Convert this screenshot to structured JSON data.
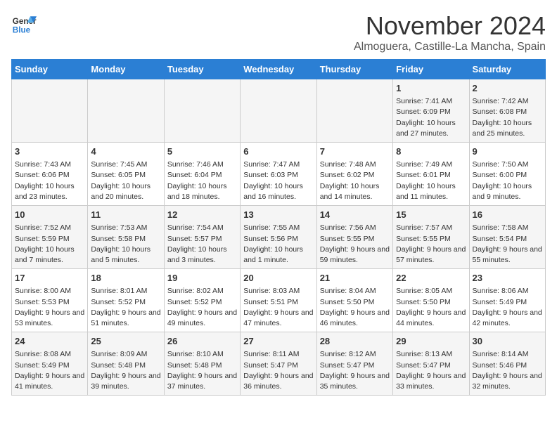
{
  "header": {
    "logo_line1": "General",
    "logo_line2": "Blue",
    "month": "November 2024",
    "location": "Almoguera, Castille-La Mancha, Spain"
  },
  "weekdays": [
    "Sunday",
    "Monday",
    "Tuesday",
    "Wednesday",
    "Thursday",
    "Friday",
    "Saturday"
  ],
  "weeks": [
    [
      {
        "day": "",
        "info": ""
      },
      {
        "day": "",
        "info": ""
      },
      {
        "day": "",
        "info": ""
      },
      {
        "day": "",
        "info": ""
      },
      {
        "day": "",
        "info": ""
      },
      {
        "day": "1",
        "info": "Sunrise: 7:41 AM\nSunset: 6:09 PM\nDaylight: 10 hours and 27 minutes."
      },
      {
        "day": "2",
        "info": "Sunrise: 7:42 AM\nSunset: 6:08 PM\nDaylight: 10 hours and 25 minutes."
      }
    ],
    [
      {
        "day": "3",
        "info": "Sunrise: 7:43 AM\nSunset: 6:06 PM\nDaylight: 10 hours and 23 minutes."
      },
      {
        "day": "4",
        "info": "Sunrise: 7:45 AM\nSunset: 6:05 PM\nDaylight: 10 hours and 20 minutes."
      },
      {
        "day": "5",
        "info": "Sunrise: 7:46 AM\nSunset: 6:04 PM\nDaylight: 10 hours and 18 minutes."
      },
      {
        "day": "6",
        "info": "Sunrise: 7:47 AM\nSunset: 6:03 PM\nDaylight: 10 hours and 16 minutes."
      },
      {
        "day": "7",
        "info": "Sunrise: 7:48 AM\nSunset: 6:02 PM\nDaylight: 10 hours and 14 minutes."
      },
      {
        "day": "8",
        "info": "Sunrise: 7:49 AM\nSunset: 6:01 PM\nDaylight: 10 hours and 11 minutes."
      },
      {
        "day": "9",
        "info": "Sunrise: 7:50 AM\nSunset: 6:00 PM\nDaylight: 10 hours and 9 minutes."
      }
    ],
    [
      {
        "day": "10",
        "info": "Sunrise: 7:52 AM\nSunset: 5:59 PM\nDaylight: 10 hours and 7 minutes."
      },
      {
        "day": "11",
        "info": "Sunrise: 7:53 AM\nSunset: 5:58 PM\nDaylight: 10 hours and 5 minutes."
      },
      {
        "day": "12",
        "info": "Sunrise: 7:54 AM\nSunset: 5:57 PM\nDaylight: 10 hours and 3 minutes."
      },
      {
        "day": "13",
        "info": "Sunrise: 7:55 AM\nSunset: 5:56 PM\nDaylight: 10 hours and 1 minute."
      },
      {
        "day": "14",
        "info": "Sunrise: 7:56 AM\nSunset: 5:55 PM\nDaylight: 9 hours and 59 minutes."
      },
      {
        "day": "15",
        "info": "Sunrise: 7:57 AM\nSunset: 5:55 PM\nDaylight: 9 hours and 57 minutes."
      },
      {
        "day": "16",
        "info": "Sunrise: 7:58 AM\nSunset: 5:54 PM\nDaylight: 9 hours and 55 minutes."
      }
    ],
    [
      {
        "day": "17",
        "info": "Sunrise: 8:00 AM\nSunset: 5:53 PM\nDaylight: 9 hours and 53 minutes."
      },
      {
        "day": "18",
        "info": "Sunrise: 8:01 AM\nSunset: 5:52 PM\nDaylight: 9 hours and 51 minutes."
      },
      {
        "day": "19",
        "info": "Sunrise: 8:02 AM\nSunset: 5:52 PM\nDaylight: 9 hours and 49 minutes."
      },
      {
        "day": "20",
        "info": "Sunrise: 8:03 AM\nSunset: 5:51 PM\nDaylight: 9 hours and 47 minutes."
      },
      {
        "day": "21",
        "info": "Sunrise: 8:04 AM\nSunset: 5:50 PM\nDaylight: 9 hours and 46 minutes."
      },
      {
        "day": "22",
        "info": "Sunrise: 8:05 AM\nSunset: 5:50 PM\nDaylight: 9 hours and 44 minutes."
      },
      {
        "day": "23",
        "info": "Sunrise: 8:06 AM\nSunset: 5:49 PM\nDaylight: 9 hours and 42 minutes."
      }
    ],
    [
      {
        "day": "24",
        "info": "Sunrise: 8:08 AM\nSunset: 5:49 PM\nDaylight: 9 hours and 41 minutes."
      },
      {
        "day": "25",
        "info": "Sunrise: 8:09 AM\nSunset: 5:48 PM\nDaylight: 9 hours and 39 minutes."
      },
      {
        "day": "26",
        "info": "Sunrise: 8:10 AM\nSunset: 5:48 PM\nDaylight: 9 hours and 37 minutes."
      },
      {
        "day": "27",
        "info": "Sunrise: 8:11 AM\nSunset: 5:47 PM\nDaylight: 9 hours and 36 minutes."
      },
      {
        "day": "28",
        "info": "Sunrise: 8:12 AM\nSunset: 5:47 PM\nDaylight: 9 hours and 35 minutes."
      },
      {
        "day": "29",
        "info": "Sunrise: 8:13 AM\nSunset: 5:47 PM\nDaylight: 9 hours and 33 minutes."
      },
      {
        "day": "30",
        "info": "Sunrise: 8:14 AM\nSunset: 5:46 PM\nDaylight: 9 hours and 32 minutes."
      }
    ]
  ]
}
